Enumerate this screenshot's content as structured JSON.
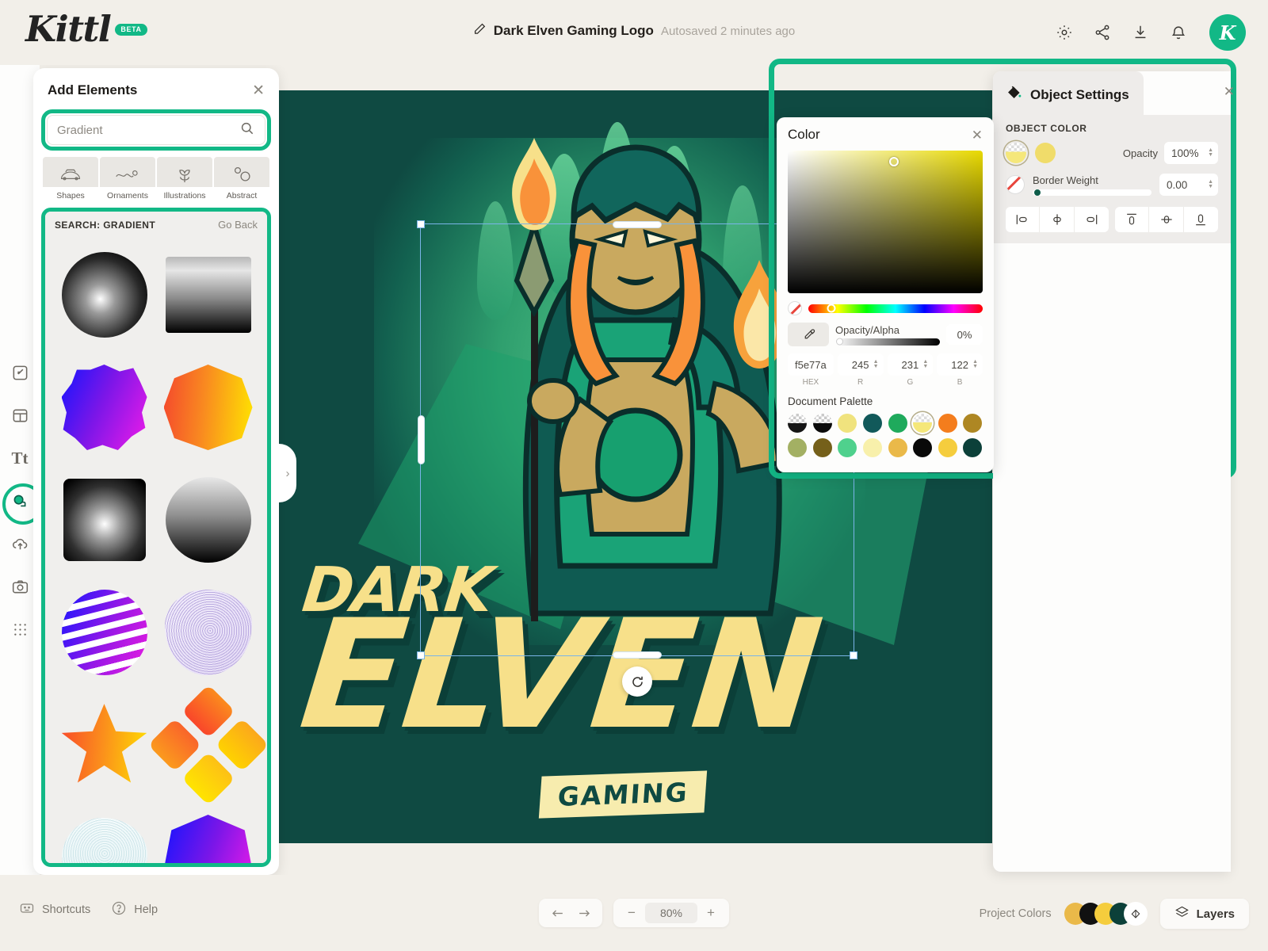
{
  "app": {
    "brand": "Kittl",
    "beta": "BETA"
  },
  "header": {
    "doc_title": "Dark Elven Gaming Logo",
    "autosave": "Autosaved 2 minutes ago",
    "avatar_initial": "K",
    "icons": [
      "gear-icon",
      "share-icon",
      "download-icon",
      "bell-icon"
    ]
  },
  "rail": {
    "items": [
      {
        "name": "design-tool",
        "icon": "pencil-square-icon"
      },
      {
        "name": "templates-tool",
        "icon": "layout-icon"
      },
      {
        "name": "text-tool",
        "icon": "text-icon",
        "glyph": "Tt"
      },
      {
        "name": "elements-tool",
        "icon": "elements-icon",
        "active": true
      },
      {
        "name": "uploads-tool",
        "icon": "cloud-upload-icon"
      },
      {
        "name": "photos-tool",
        "icon": "camera-icon"
      },
      {
        "name": "patterns-tool",
        "icon": "grid-dots-icon"
      }
    ]
  },
  "elements_panel": {
    "title": "Add Elements",
    "close_label": "✕",
    "search": {
      "value": "Gradient",
      "placeholder": "Gradient"
    },
    "categories": [
      {
        "label": "Shapes",
        "icon": "shapes-icon"
      },
      {
        "label": "Ornaments",
        "icon": "ornaments-icon"
      },
      {
        "label": "Illustrations",
        "icon": "illustrations-icon"
      },
      {
        "label": "Abstract",
        "icon": "abstract-icon"
      }
    ],
    "results_label": "SEARCH: GRADIENT",
    "go_back": "Go Back",
    "thumbnails": [
      {
        "name": "radial-sphere-gradient"
      },
      {
        "name": "linear-square-gradient"
      },
      {
        "name": "blob-blue-magenta-gradient"
      },
      {
        "name": "hexagon-orange-yellow-gradient"
      },
      {
        "name": "radial-square-gradient"
      },
      {
        "name": "circle-linear-gradient"
      },
      {
        "name": "striped-sphere-gradient"
      },
      {
        "name": "wireframe-blob-gradient"
      },
      {
        "name": "star-orange-gradient"
      },
      {
        "name": "pinwheel-orange-gradient"
      },
      {
        "name": "wireframe-pale-blob"
      },
      {
        "name": "hexagon-blue-magenta-gradient"
      }
    ]
  },
  "canvas": {
    "artwork": {
      "word_top": "DARK",
      "word_main": "ELVEN",
      "badge": "GAMING"
    },
    "selection": {
      "rotate_icon": "rotate-icon"
    },
    "collapse_icon": "chevron-right-icon"
  },
  "color_panel": {
    "title": "Color",
    "close_label": "✕",
    "opacity_alpha_label": "Opacity/Alpha",
    "alpha_value": "0%",
    "hex": "f5e77a",
    "r": "245",
    "g": "231",
    "b": "122",
    "labels": {
      "hex": "HEX",
      "r": "R",
      "g": "G",
      "b": "B"
    },
    "document_palette_label": "Document Palette",
    "palette": [
      {
        "name": "black-gradient-swatch",
        "hex": "#151515",
        "checker": true
      },
      {
        "name": "black-solid-swatch",
        "hex": "#0b0b0b",
        "checker": true
      },
      {
        "name": "pale-yellow-swatch",
        "hex": "#f0e37e"
      },
      {
        "name": "dark-teal-swatch",
        "hex": "#11595a"
      },
      {
        "name": "green-swatch",
        "hex": "#1faa5c"
      },
      {
        "name": "selected-yellow-swatch",
        "hex": "#f5e77a",
        "checker": true,
        "selected": true
      },
      {
        "name": "orange-swatch",
        "hex": "#f47d1d"
      },
      {
        "name": "dark-gold-swatch",
        "hex": "#ae8723"
      },
      {
        "name": "olive-swatch",
        "hex": "#a3b063"
      },
      {
        "name": "dark-olive-swatch",
        "hex": "#75601a"
      },
      {
        "name": "mint-green-swatch",
        "hex": "#4fd18d"
      },
      {
        "name": "light-cream-swatch",
        "hex": "#f8f0ab"
      },
      {
        "name": "sand-swatch",
        "hex": "#eab949"
      },
      {
        "name": "black-swatch",
        "hex": "#090909"
      },
      {
        "name": "yellow-swatch",
        "hex": "#f5cd3d"
      },
      {
        "name": "deep-teal-swatch",
        "hex": "#0c4039"
      }
    ]
  },
  "object_settings": {
    "title": "Object Settings",
    "icon": "paint-bucket-icon",
    "close_label": "✕",
    "object_color_label": "OBJECT COLOR",
    "swatches": [
      {
        "name": "object-color-swatch-selected",
        "hex": "#f5e77a",
        "checker": true,
        "selected": true
      },
      {
        "name": "object-color-swatch-yellow",
        "hex": "#f0dc6a"
      }
    ],
    "opacity_label": "Opacity",
    "opacity_value": "100%",
    "border_weight_label": "Border Weight",
    "border_weight_value": "0.00",
    "align_buttons": [
      {
        "name": "align-left-icon"
      },
      {
        "name": "align-center-horizontal-icon"
      },
      {
        "name": "align-right-icon"
      },
      {
        "name": "align-top-icon"
      },
      {
        "name": "align-middle-vertical-icon"
      },
      {
        "name": "align-bottom-icon"
      }
    ]
  },
  "bottom_bar": {
    "shortcuts": "Shortcuts",
    "help": "Help",
    "undo_icon": "undo-icon",
    "redo_icon": "redo-icon",
    "zoom_out": "−",
    "zoom_value": "80%",
    "zoom_in": "+",
    "project_colors_label": "Project Colors",
    "project_colors": [
      "#eab949",
      "#111111",
      "#f5cd3d",
      "#0c4039"
    ],
    "layers_label": "Layers"
  }
}
